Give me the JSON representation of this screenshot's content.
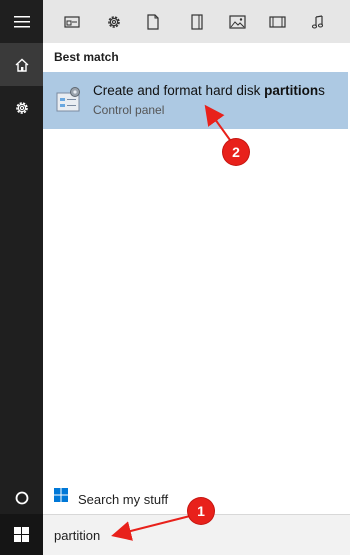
{
  "rail": {
    "items": [
      {
        "icon": "hamburger-menu-icon"
      },
      {
        "icon": "home-icon",
        "selected": true
      },
      {
        "icon": "settings-gear-icon"
      },
      {
        "icon": "cortana-circle-icon"
      },
      {
        "icon": "windows-start-icon"
      }
    ],
    "accent_color": "#2b88d8"
  },
  "toolbar": {
    "filters": [
      {
        "icon": "apps-filter-icon"
      },
      {
        "icon": "settings-filter-icon"
      },
      {
        "icon": "documents-filter-icon"
      },
      {
        "icon": "folders-filter-icon"
      },
      {
        "icon": "photos-filter-icon"
      },
      {
        "icon": "videos-filter-icon"
      },
      {
        "icon": "music-filter-icon"
      }
    ]
  },
  "results": {
    "section_title": "Best match",
    "best_match": {
      "title_prefix": "Create and format hard disk ",
      "title_match": "partition",
      "title_suffix": "s",
      "subtitle": "Control panel",
      "icon": "disk-management-icon",
      "highlight_color": "#adc9e3"
    }
  },
  "search_stuff": {
    "label": "Search my stuff",
    "icon": "windows-logo-icon"
  },
  "search_box": {
    "value": "partition",
    "placeholder": ""
  },
  "annotations": {
    "badge_1": "1",
    "badge_2": "2",
    "color": "#e8211b"
  }
}
